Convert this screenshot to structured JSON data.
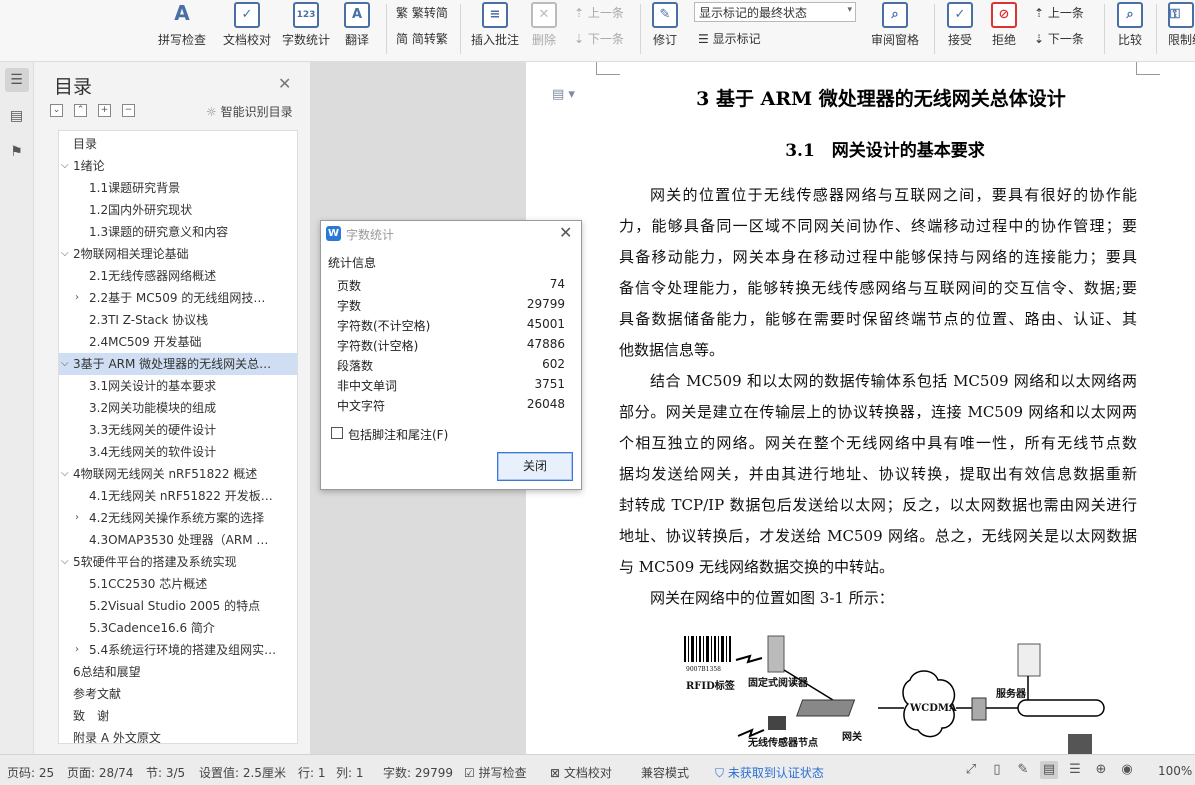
{
  "ribbon": {
    "spell_check": "拼写检查",
    "doc_proof": "文档校对",
    "word_count": "字数统计",
    "translate": "翻译",
    "trad_simp": "繁转简",
    "simp_trad": "简转繁",
    "insert_comment": "插入批注",
    "delete": "删除",
    "prev1": "上一条",
    "next1": "下一条",
    "revise": "修订",
    "revision_mode": "显示标记的最终状态",
    "show_marks": "显示标记",
    "review_pane": "审阅窗格",
    "accept": "接受",
    "reject": "拒绝",
    "prev2": "上一条",
    "next2": "下一条",
    "compare": "比较",
    "restrict": "限制编"
  },
  "toc": {
    "title": "目录",
    "smart_label": "智能识别目录",
    "items": [
      {
        "label": "目录",
        "level": 0,
        "arrow": ""
      },
      {
        "label": "1绪论",
        "level": 0,
        "arrow": "down"
      },
      {
        "label": "1.1课题研究背景",
        "level": 1,
        "arrow": ""
      },
      {
        "label": "1.2国内外研究现状",
        "level": 1,
        "arrow": ""
      },
      {
        "label": "1.3课题的研究意义和内容",
        "level": 1,
        "arrow": ""
      },
      {
        "label": "2物联网相关理论基础",
        "level": 0,
        "arrow": "down"
      },
      {
        "label": "2.1无线传感器网络概述",
        "level": 1,
        "arrow": ""
      },
      {
        "label": "2.2基于 MC509 的无线组网技术…",
        "level": 1,
        "arrow": "right"
      },
      {
        "label": "2.3TI Z-Stack 协议栈",
        "level": 1,
        "arrow": ""
      },
      {
        "label": "2.4MC509 开发基础",
        "level": 1,
        "arrow": ""
      },
      {
        "label": "3基于 ARM 微处理器的无线网关总…",
        "level": 0,
        "arrow": "down",
        "selected": true
      },
      {
        "label": "3.1网关设计的基本要求",
        "level": 1,
        "arrow": ""
      },
      {
        "label": "3.2网关功能模块的组成",
        "level": 1,
        "arrow": ""
      },
      {
        "label": "3.3无线网关的硬件设计",
        "level": 1,
        "arrow": ""
      },
      {
        "label": "3.4无线网关的软件设计",
        "level": 1,
        "arrow": ""
      },
      {
        "label": "4物联网无线网关 nRF51822 概述",
        "level": 0,
        "arrow": "down"
      },
      {
        "label": "4.1无线网关 nRF51822 开发板…",
        "level": 1,
        "arrow": ""
      },
      {
        "label": "4.2无线网关操作系统方案的选择",
        "level": 1,
        "arrow": "right"
      },
      {
        "label": "4.3OMAP3530 处理器（ARM …",
        "level": 1,
        "arrow": ""
      },
      {
        "label": "5软硬件平台的搭建及系统实现",
        "level": 0,
        "arrow": "down"
      },
      {
        "label": "5.1CC2530 芯片概述",
        "level": 1,
        "arrow": ""
      },
      {
        "label": "5.2Visual Studio 2005 的特点",
        "level": 1,
        "arrow": ""
      },
      {
        "label": "5.3Cadence16.6 简介",
        "level": 1,
        "arrow": ""
      },
      {
        "label": "5.4系统运行环境的搭建及组网实…",
        "level": 1,
        "arrow": "right"
      },
      {
        "label": "6总结和展望",
        "level": 0,
        "arrow": ""
      },
      {
        "label": "参考文献",
        "level": 0,
        "arrow": ""
      },
      {
        "label": "致　谢",
        "level": 0,
        "arrow": ""
      },
      {
        "label": "附录 A 外文原文",
        "level": 0,
        "arrow": ""
      }
    ]
  },
  "dialog": {
    "title": "字数统计",
    "section": "统计信息",
    "stats": [
      {
        "k": "页数",
        "v": "74"
      },
      {
        "k": "字数",
        "v": "29799"
      },
      {
        "k": "字符数(不计空格)",
        "v": "45001"
      },
      {
        "k": "字符数(计空格)",
        "v": "47886"
      },
      {
        "k": "段落数",
        "v": "602"
      },
      {
        "k": "非中文单词",
        "v": "3751"
      },
      {
        "k": "中文字符",
        "v": "26048"
      }
    ],
    "footnote_label": "包括脚注和尾注(F)",
    "close_label": "关闭"
  },
  "doc": {
    "h1": "3 基于 ARM 微处理器的无线网关总体设计",
    "h2": "3.1　网关设计的基本要求",
    "lines": [
      {
        "t": "网关的位置位于无线传感器网络与互联网之间，要具有很好的协作能",
        "cls": "ind"
      },
      {
        "t": "力，能够具备同一区域不同网关间协作、终端移动过程中的协作管理；要",
        "cls": ""
      },
      {
        "t": "具备移动能力，网关本身在移动过程中能够保持与网络的连接能力；要具",
        "cls": ""
      },
      {
        "t": "备信令处理能力，能够转换无线传感网络与互联网间的交互信令、数据;要",
        "cls": ""
      },
      {
        "t": "具备数据储备能力，能够在需要时保留终端节点的位置、路由、认证、其",
        "cls": ""
      },
      {
        "t": "他数据信息等。",
        "cls": "last"
      },
      {
        "t": "结合 MC509 和以太网的数据传输体系包括 MC509 网络和以太网络两",
        "cls": "ind"
      },
      {
        "t": "部分。网关是建立在传输层上的协议转换器，连接 MC509 网络和以太网两",
        "cls": ""
      },
      {
        "t": "个相互独立的网络。网关在整个无线网络中具有唯一性，所有无线节点数",
        "cls": ""
      },
      {
        "t": "据均发送给网关，并由其进行地址、协议转换，提取出有效信息数据重新",
        "cls": ""
      },
      {
        "t": "封转成 TCP/IP 数据包后发送给以太网；反之，以太网数据也需由网关进行",
        "cls": ""
      },
      {
        "t": "地址、协议转换后，才发送给 MC509 网络。总之，无线网关是以太网数据",
        "cls": ""
      },
      {
        "t": "与 MC509 无线网络数据交换的中转站。",
        "cls": "last"
      },
      {
        "t": "网关在网络中的位置如图 3-1 所示：",
        "cls": "ind last"
      }
    ],
    "figure": {
      "barcode_num": "9007B1358",
      "rfid": "RFID标签",
      "reader": "固定式阅读器",
      "wcdma": "WCDMA",
      "server": "服务器",
      "node": "无线传感器节点",
      "gateway": "网关"
    }
  },
  "status": {
    "page_num": "页码: 25",
    "page": "页面: 28/74",
    "section": "节: 3/5",
    "setting": "设置值: 2.5厘米",
    "row": "行: 1",
    "col": "列: 1",
    "words": "字数: 29799",
    "spell": "拼写检查",
    "proof": "文档校对",
    "compat": "兼容模式",
    "cert": "未获取到认证状态",
    "zoom": "100%"
  }
}
